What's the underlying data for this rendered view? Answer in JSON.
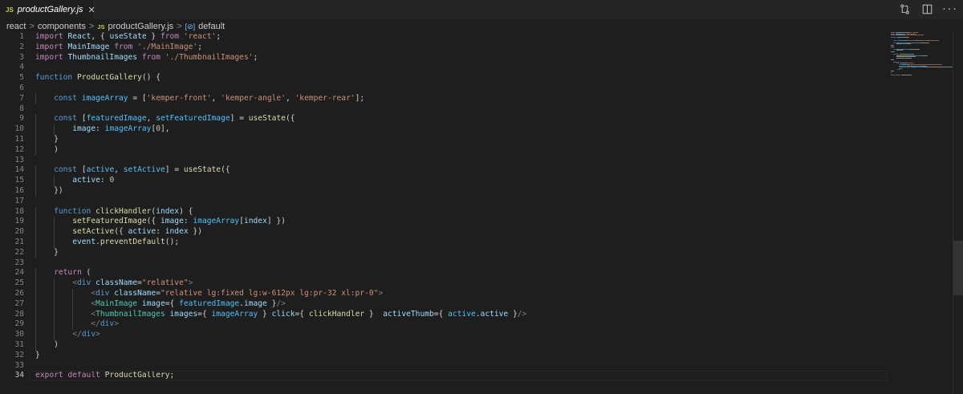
{
  "tab": {
    "badge": "JS",
    "title": "productGallery.js",
    "close": "✕"
  },
  "actions": {
    "compare_icon": "git-compare-icon",
    "split_icon": "split-editor-icon",
    "more": "···"
  },
  "breadcrumb": {
    "items": [
      "react",
      "components",
      "productGallery.js",
      "default"
    ],
    "js_badge": "JS",
    "symbol_badge": "[⊘]",
    "separator": ">"
  },
  "editor": {
    "current_line": 34,
    "lines": [
      {
        "n": "1",
        "t": [
          [
            "kw",
            "import"
          ],
          [
            "plain",
            " "
          ],
          [
            "var",
            "React"
          ],
          [
            "plain",
            ", { "
          ],
          [
            "var",
            "useState"
          ],
          [
            "plain",
            " } "
          ],
          [
            "kw",
            "from"
          ],
          [
            "plain",
            " "
          ],
          [
            "str",
            "'react'"
          ],
          [
            "plain",
            ";"
          ]
        ]
      },
      {
        "n": "2",
        "t": [
          [
            "kw",
            "import"
          ],
          [
            "plain",
            " "
          ],
          [
            "var",
            "MainImage"
          ],
          [
            "plain",
            " "
          ],
          [
            "kw",
            "from"
          ],
          [
            "plain",
            " "
          ],
          [
            "str",
            "'./MainImage'"
          ],
          [
            "plain",
            ";"
          ]
        ]
      },
      {
        "n": "3",
        "t": [
          [
            "kw",
            "import"
          ],
          [
            "plain",
            " "
          ],
          [
            "var",
            "ThumbnailImages"
          ],
          [
            "plain",
            " "
          ],
          [
            "kw",
            "from"
          ],
          [
            "plain",
            " "
          ],
          [
            "str",
            "'./ThumbnailImages'"
          ],
          [
            "plain",
            ";"
          ]
        ]
      },
      {
        "n": "4",
        "t": []
      },
      {
        "n": "5",
        "t": [
          [
            "st",
            "function"
          ],
          [
            "plain",
            " "
          ],
          [
            "fn",
            "ProductGallery"
          ],
          [
            "plain",
            "() {"
          ]
        ]
      },
      {
        "n": "6",
        "t": []
      },
      {
        "n": "7",
        "t": [
          [
            "plain",
            "    "
          ],
          [
            "st",
            "const"
          ],
          [
            "plain",
            " "
          ],
          [
            "cst",
            "imageArray"
          ],
          [
            "plain",
            " = ["
          ],
          [
            "str",
            "'kemper-front'"
          ],
          [
            "plain",
            ", "
          ],
          [
            "str",
            "'kemper-angle'"
          ],
          [
            "plain",
            ", "
          ],
          [
            "str",
            "'kemper-rear'"
          ],
          [
            "plain",
            "];"
          ]
        ]
      },
      {
        "n": "8",
        "t": []
      },
      {
        "n": "9",
        "t": [
          [
            "plain",
            "    "
          ],
          [
            "st",
            "const"
          ],
          [
            "plain",
            " ["
          ],
          [
            "cst",
            "featuredImage"
          ],
          [
            "plain",
            ", "
          ],
          [
            "cst",
            "setFeaturedImage"
          ],
          [
            "plain",
            "] = "
          ],
          [
            "fn",
            "useState"
          ],
          [
            "plain",
            "({"
          ]
        ]
      },
      {
        "n": "10",
        "t": [
          [
            "plain",
            "        "
          ],
          [
            "var",
            "image"
          ],
          [
            "plain",
            ": "
          ],
          [
            "cst",
            "imageArray"
          ],
          [
            "plain",
            "["
          ],
          [
            "num",
            "0"
          ],
          [
            "plain",
            "],"
          ]
        ]
      },
      {
        "n": "11",
        "t": [
          [
            "plain",
            "    }"
          ]
        ]
      },
      {
        "n": "12",
        "t": [
          [
            "plain",
            "    )"
          ]
        ]
      },
      {
        "n": "13",
        "t": []
      },
      {
        "n": "14",
        "t": [
          [
            "plain",
            "    "
          ],
          [
            "st",
            "const"
          ],
          [
            "plain",
            " ["
          ],
          [
            "cst",
            "active"
          ],
          [
            "plain",
            ", "
          ],
          [
            "cst",
            "setActive"
          ],
          [
            "plain",
            "] = "
          ],
          [
            "fn",
            "useState"
          ],
          [
            "plain",
            "({"
          ]
        ]
      },
      {
        "n": "15",
        "t": [
          [
            "plain",
            "        "
          ],
          [
            "var",
            "active"
          ],
          [
            "plain",
            ": "
          ],
          [
            "num",
            "0"
          ]
        ]
      },
      {
        "n": "16",
        "t": [
          [
            "plain",
            "    })"
          ]
        ]
      },
      {
        "n": "17",
        "t": []
      },
      {
        "n": "18",
        "t": [
          [
            "plain",
            "    "
          ],
          [
            "st",
            "function"
          ],
          [
            "plain",
            " "
          ],
          [
            "fn",
            "clickHandler"
          ],
          [
            "plain",
            "("
          ],
          [
            "var",
            "index"
          ],
          [
            "plain",
            ") {"
          ]
        ]
      },
      {
        "n": "19",
        "t": [
          [
            "plain",
            "        "
          ],
          [
            "fn",
            "setFeaturedImage"
          ],
          [
            "plain",
            "({ "
          ],
          [
            "var",
            "image"
          ],
          [
            "plain",
            ": "
          ],
          [
            "cst",
            "imageArray"
          ],
          [
            "plain",
            "["
          ],
          [
            "var",
            "index"
          ],
          [
            "plain",
            "] })"
          ]
        ]
      },
      {
        "n": "20",
        "t": [
          [
            "plain",
            "        "
          ],
          [
            "fn",
            "setActive"
          ],
          [
            "plain",
            "({ "
          ],
          [
            "var",
            "active"
          ],
          [
            "plain",
            ": "
          ],
          [
            "var",
            "index"
          ],
          [
            "plain",
            " })"
          ]
        ]
      },
      {
        "n": "21",
        "t": [
          [
            "plain",
            "        "
          ],
          [
            "var",
            "event"
          ],
          [
            "plain",
            "."
          ],
          [
            "fn",
            "preventDefault"
          ],
          [
            "plain",
            "();"
          ]
        ]
      },
      {
        "n": "22",
        "t": [
          [
            "plain",
            "    }"
          ]
        ]
      },
      {
        "n": "23",
        "t": []
      },
      {
        "n": "24",
        "t": [
          [
            "plain",
            "    "
          ],
          [
            "kw",
            "return"
          ],
          [
            "plain",
            " ("
          ]
        ]
      },
      {
        "n": "25",
        "t": [
          [
            "plain",
            "        "
          ],
          [
            "tag",
            "<"
          ],
          [
            "htag",
            "div"
          ],
          [
            "plain",
            " "
          ],
          [
            "attr",
            "className"
          ],
          [
            "plain",
            "="
          ],
          [
            "str",
            "\"relative\""
          ],
          [
            "tag",
            ">"
          ]
        ]
      },
      {
        "n": "26",
        "t": [
          [
            "plain",
            "            "
          ],
          [
            "tag",
            "<"
          ],
          [
            "htag",
            "div"
          ],
          [
            "plain",
            " "
          ],
          [
            "attr",
            "className"
          ],
          [
            "plain",
            "="
          ],
          [
            "str",
            "\"relative lg:fixed lg:w-612px lg:pr-32 xl:pr-0\""
          ],
          [
            "tag",
            ">"
          ]
        ]
      },
      {
        "n": "27",
        "t": [
          [
            "plain",
            "            "
          ],
          [
            "tag",
            "<"
          ],
          [
            "cmp",
            "MainImage"
          ],
          [
            "plain",
            " "
          ],
          [
            "attr",
            "image"
          ],
          [
            "plain",
            "={ "
          ],
          [
            "cst",
            "featuredImage"
          ],
          [
            "plain",
            "."
          ],
          [
            "var",
            "image"
          ],
          [
            "plain",
            " }"
          ],
          [
            "tag",
            "/>"
          ]
        ]
      },
      {
        "n": "28",
        "t": [
          [
            "plain",
            "            "
          ],
          [
            "tag",
            "<"
          ],
          [
            "cmp",
            "ThumbnailImages"
          ],
          [
            "plain",
            " "
          ],
          [
            "attr",
            "images"
          ],
          [
            "plain",
            "={ "
          ],
          [
            "cst",
            "imageArray"
          ],
          [
            "plain",
            " } "
          ],
          [
            "attr",
            "click"
          ],
          [
            "plain",
            "={ "
          ],
          [
            "fn",
            "clickHandler"
          ],
          [
            "plain",
            " }  "
          ],
          [
            "attr",
            "activeThumb"
          ],
          [
            "plain",
            "={ "
          ],
          [
            "cst",
            "active"
          ],
          [
            "plain",
            "."
          ],
          [
            "var",
            "active"
          ],
          [
            "plain",
            " }"
          ],
          [
            "tag",
            "/>"
          ]
        ]
      },
      {
        "n": "29",
        "t": [
          [
            "plain",
            "            "
          ],
          [
            "tag",
            "</"
          ],
          [
            "htag",
            "div"
          ],
          [
            "tag",
            ">"
          ]
        ]
      },
      {
        "n": "30",
        "t": [
          [
            "plain",
            "        "
          ],
          [
            "tag",
            "</"
          ],
          [
            "htag",
            "div"
          ],
          [
            "tag",
            ">"
          ]
        ]
      },
      {
        "n": "31",
        "t": [
          [
            "plain",
            "    )"
          ]
        ]
      },
      {
        "n": "32",
        "t": [
          [
            "plain",
            "}"
          ]
        ]
      },
      {
        "n": "33",
        "t": []
      },
      {
        "n": "34",
        "t": [
          [
            "kw",
            "export"
          ],
          [
            "plain",
            " "
          ],
          [
            "kw",
            "default"
          ],
          [
            "plain",
            " "
          ],
          [
            "fn",
            "ProductGallery"
          ],
          [
            "plain",
            ";"
          ]
        ]
      }
    ]
  }
}
